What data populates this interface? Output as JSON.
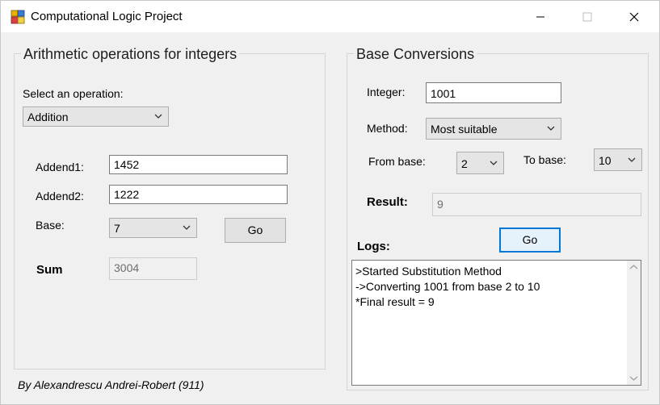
{
  "window": {
    "title": "Computational Logic Project"
  },
  "arith": {
    "title": "Arithmetic operations for integers",
    "select_label": "Select an operation:",
    "operation": "Addition",
    "addend1_label": "Addend1:",
    "addend1_value": "1452",
    "addend2_label": "Addend2:",
    "addend2_value": "1222",
    "base_label": "Base:",
    "base_value": "7",
    "go_label": "Go",
    "sum_label": "Sum",
    "sum_value": "3004"
  },
  "conv": {
    "title": "Base Conversions",
    "integer_label": "Integer:",
    "integer_value": "1001",
    "method_label": "Method:",
    "method_value": "Most suitable",
    "from_label": "From base:",
    "from_value": "2",
    "to_label": "To base:",
    "to_value": "10",
    "result_label": "Result:",
    "result_value": "9",
    "go_label": "Go",
    "logs_label": "Logs:",
    "logs": [
      ">Started Substitution Method",
      "->Converting 1001 from base 2 to 10",
      "*Final result = 9"
    ]
  },
  "footer": "By Alexandrescu Andrei-Robert (911)",
  "icons": {
    "app": "app-icon",
    "minimize": "minimize-icon",
    "maximize": "maximize-icon",
    "close": "close-icon",
    "dropdown": "chevron-down-icon"
  },
  "colors": {
    "focus": "#0078d7",
    "window_bg": "#f0f0f0"
  }
}
